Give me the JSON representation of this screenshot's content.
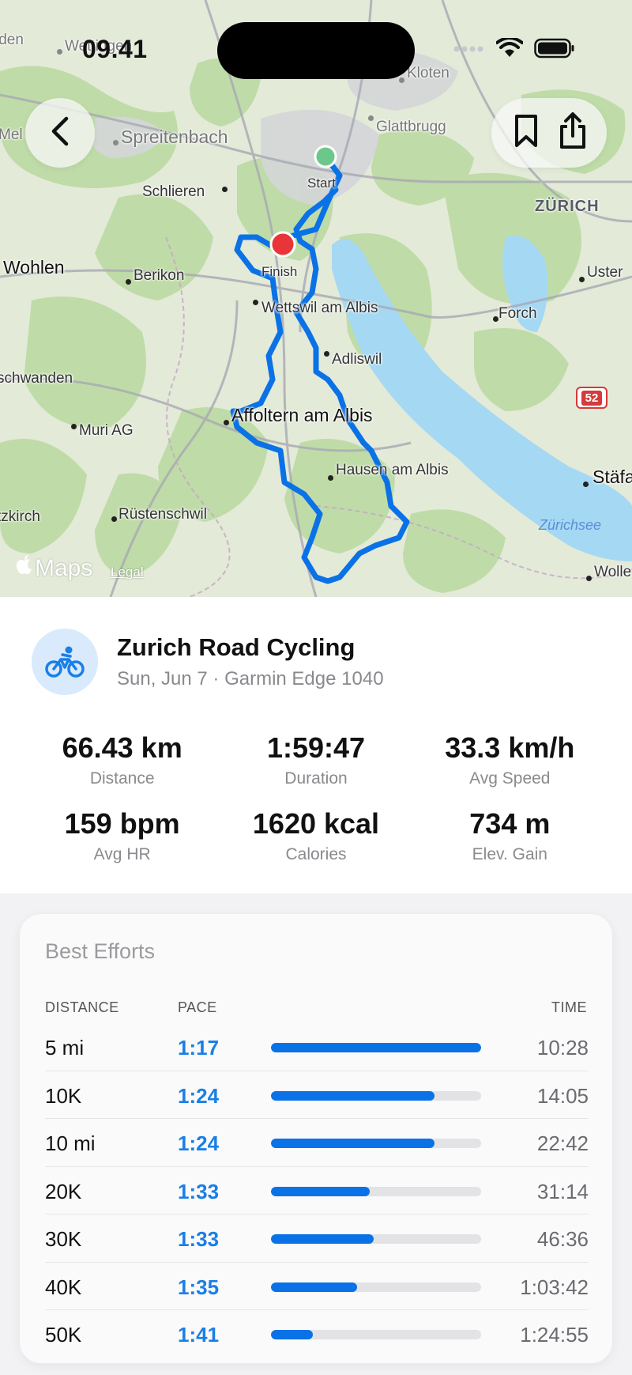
{
  "status_bar": {
    "time": "09.41"
  },
  "map": {
    "places": [
      {
        "name": "Kloten",
        "cls": "dim"
      },
      {
        "name": "Spreitenbach",
        "cls": "big dim"
      },
      {
        "name": "Glattbrugg",
        "cls": "dim"
      },
      {
        "name": "Schlieren",
        "cls": ""
      },
      {
        "name": "ZÜRICH",
        "cls": "caps"
      },
      {
        "name": "Wohlen",
        "cls": "big"
      },
      {
        "name": "Berikon",
        "cls": ""
      },
      {
        "name": "Uster",
        "cls": ""
      },
      {
        "name": "Wettswil am Albis",
        "cls": ""
      },
      {
        "name": "Forch",
        "cls": ""
      },
      {
        "name": "Adliswil",
        "cls": ""
      },
      {
        "name": "schwanden",
        "cls": ""
      },
      {
        "name": "Affoltern am Albis",
        "cls": "big"
      },
      {
        "name": "Muri AG",
        "cls": ""
      },
      {
        "name": "Hausen am Albis",
        "cls": ""
      },
      {
        "name": "Stäfa",
        "cls": "big"
      },
      {
        "name": "tzkirch",
        "cls": ""
      },
      {
        "name": "Rüstenschwil",
        "cls": ""
      },
      {
        "name": "Zürichsee",
        "cls": "lake"
      },
      {
        "name": "Wolle",
        "cls": ""
      },
      {
        "name": "Mel",
        "cls": "dim"
      },
      {
        "name": "Wettingen",
        "cls": "dim"
      },
      {
        "name": "iden",
        "cls": "dim"
      }
    ],
    "start_label": "Start",
    "finish_label": "Finish",
    "road_shield": "52",
    "route_color": "#0a72e6",
    "start_color": "#6cc88a",
    "finish_color": "#e8353a",
    "maps_brand": "Maps",
    "legal": "Legal"
  },
  "activity": {
    "title": "Zurich Road Cycling",
    "subtitle": "Sun, Jun 7 · Garmin Edge 1040",
    "icon": "bicycle-icon"
  },
  "stats": [
    {
      "value": "66.43 km",
      "label": "Distance"
    },
    {
      "value": "1:59:47",
      "label": "Duration"
    },
    {
      "value": "33.3 km/h",
      "label": "Avg Speed"
    },
    {
      "value": "159 bpm",
      "label": "Avg HR"
    },
    {
      "value": "1620 kcal",
      "label": "Calories"
    },
    {
      "value": "734 m",
      "label": "Elev. Gain"
    }
  ],
  "best_efforts": {
    "title": "Best Efforts",
    "col_distance": "DISTANCE",
    "col_pace": "PACE",
    "col_time": "TIME",
    "rows": [
      {
        "distance": "5 mi",
        "pace": "1:17",
        "time": "10:28",
        "fill": 1.0
      },
      {
        "distance": "10K",
        "pace": "1:24",
        "time": "14:05",
        "fill": 0.78
      },
      {
        "distance": "10 mi",
        "pace": "1:24",
        "time": "22:42",
        "fill": 0.78
      },
      {
        "distance": "20K",
        "pace": "1:33",
        "time": "31:14",
        "fill": 0.47
      },
      {
        "distance": "30K",
        "pace": "1:33",
        "time": "46:36",
        "fill": 0.49
      },
      {
        "distance": "40K",
        "pace": "1:35",
        "time": "1:03:42",
        "fill": 0.41
      },
      {
        "distance": "50K",
        "pace": "1:41",
        "time": "1:24:55",
        "fill": 0.2
      }
    ]
  }
}
